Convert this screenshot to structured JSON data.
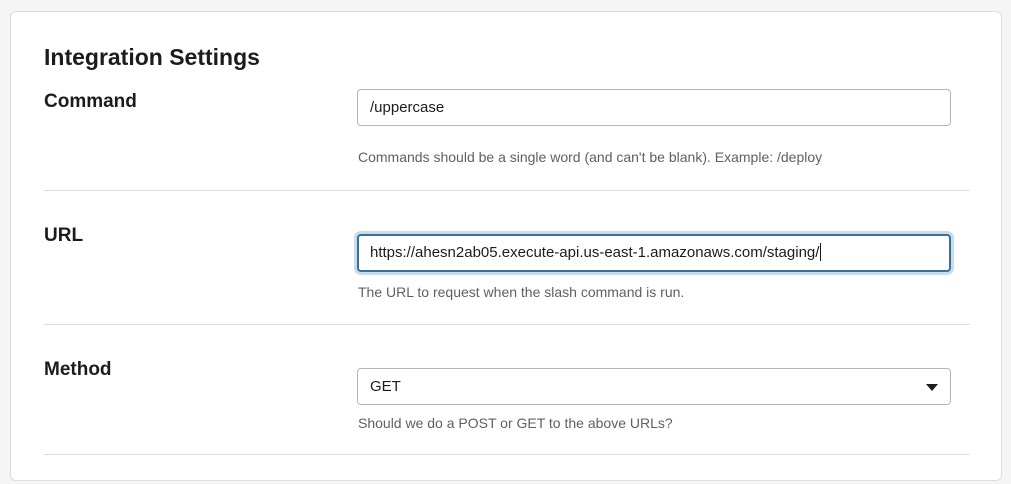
{
  "section": {
    "title": "Integration Settings"
  },
  "command": {
    "label": "Command",
    "value": "/uppercase",
    "hint": "Commands should be a single word (and can't be blank). Example: /deploy"
  },
  "url": {
    "label": "URL",
    "value": "https://ahesn2ab05.execute-api.us-east-1.amazonaws.com/staging/",
    "hint": "The URL to request when the slash command is run."
  },
  "method": {
    "label": "Method",
    "selected": "GET",
    "hint": "Should we do a POST or GET to the above URLs?"
  },
  "colors": {
    "focus_border": "#3a6f98",
    "focus_ring": "#c6ddf0",
    "hint_text": "#616061",
    "divider": "#dddddd"
  },
  "icons": {
    "method_dropdown": "chevron-down-icon"
  }
}
